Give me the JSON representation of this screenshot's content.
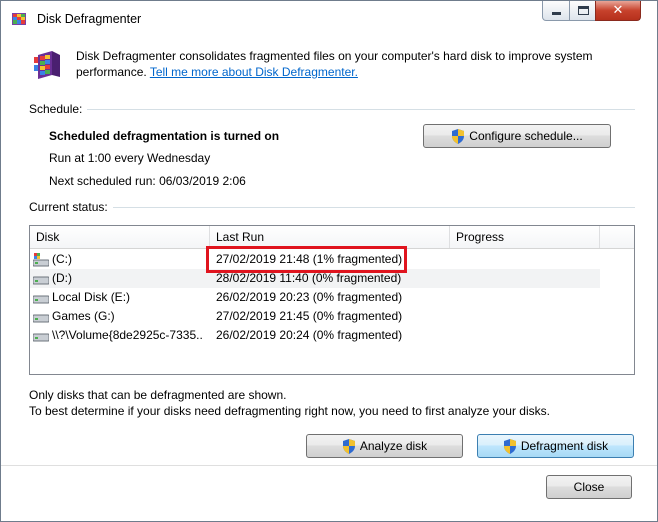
{
  "window": {
    "title": "Disk Defragmenter",
    "minimize_icon": "minimize-icon",
    "maximize_icon": "maximize-icon",
    "close_icon": "close-icon",
    "close_glyph": "✕"
  },
  "intro": {
    "text": "Disk Defragmenter consolidates fragmented files on your computer's hard disk to improve system performance.",
    "link": "Tell me more about Disk Defragmenter."
  },
  "schedule": {
    "label": "Schedule:",
    "status": "Scheduled defragmentation is turned on",
    "run_at": "Run at 1:00 every Wednesday",
    "next_run": "Next scheduled run: 06/03/2019 2:06",
    "configure_button": "Configure schedule..."
  },
  "current_status": {
    "label": "Current status:",
    "columns": [
      "Disk",
      "Last Run",
      "Progress"
    ],
    "rows": [
      {
        "disk": "(C:)",
        "last_run": "27/02/2019 21:48 (1% fragmented)",
        "progress": "",
        "icon": "system-drive-icon"
      },
      {
        "disk": "(D:)",
        "last_run": "28/02/2019 11:40 (0% fragmented)",
        "progress": "",
        "icon": "hard-drive-icon"
      },
      {
        "disk": "Local Disk (E:)",
        "last_run": "26/02/2019 20:23 (0% fragmented)",
        "progress": "",
        "icon": "hard-drive-icon"
      },
      {
        "disk": "Games (G:)",
        "last_run": "27/02/2019 21:45 (0% fragmented)",
        "progress": "",
        "icon": "hard-drive-icon"
      },
      {
        "disk": "\\\\?\\Volume{8de2925c-7335...",
        "last_run": "26/02/2019 20:24 (0% fragmented)",
        "progress": "",
        "icon": "hard-drive-icon"
      }
    ]
  },
  "notes": {
    "line1": "Only disks that can be defragmented are shown.",
    "line2": "To best determine if your disks need defragmenting right now, you need to first analyze your disks."
  },
  "buttons": {
    "analyze": "Analyze disk",
    "defragment": "Defragment disk",
    "close": "Close"
  },
  "colors": {
    "highlight": "#e0141e",
    "link": "#0066cc"
  }
}
